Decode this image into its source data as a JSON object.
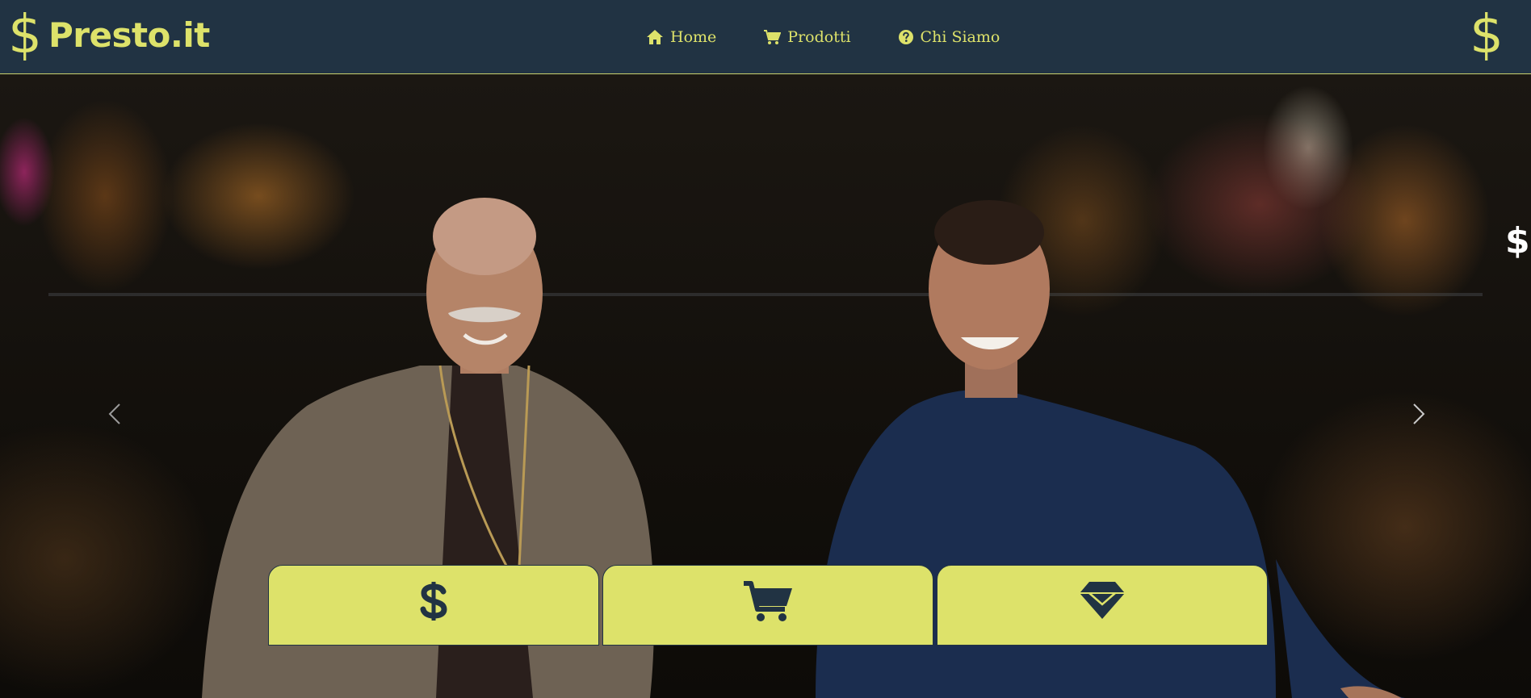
{
  "brand": {
    "symbol": "$",
    "name": "Presto.it"
  },
  "nav": {
    "home_label": "Home",
    "products_label": "Prodotti",
    "about_label": "Chi Siamo",
    "home_icon": "house-icon",
    "products_icon": "cart-icon",
    "about_icon": "question-circle-icon"
  },
  "right_symbol": "$",
  "hero": {
    "side_symbol": "$",
    "prev_icon": "chevron-left-icon",
    "next_icon": "chevron-right-icon"
  },
  "cards": [
    {
      "icon": "dollar-icon"
    },
    {
      "icon": "cart-icon"
    },
    {
      "icon": "gem-icon"
    }
  ],
  "colors": {
    "navbar_bg": "#213343",
    "accent": "#dde26a",
    "card_bg": "#dde26a",
    "icon_dark": "#213343"
  }
}
